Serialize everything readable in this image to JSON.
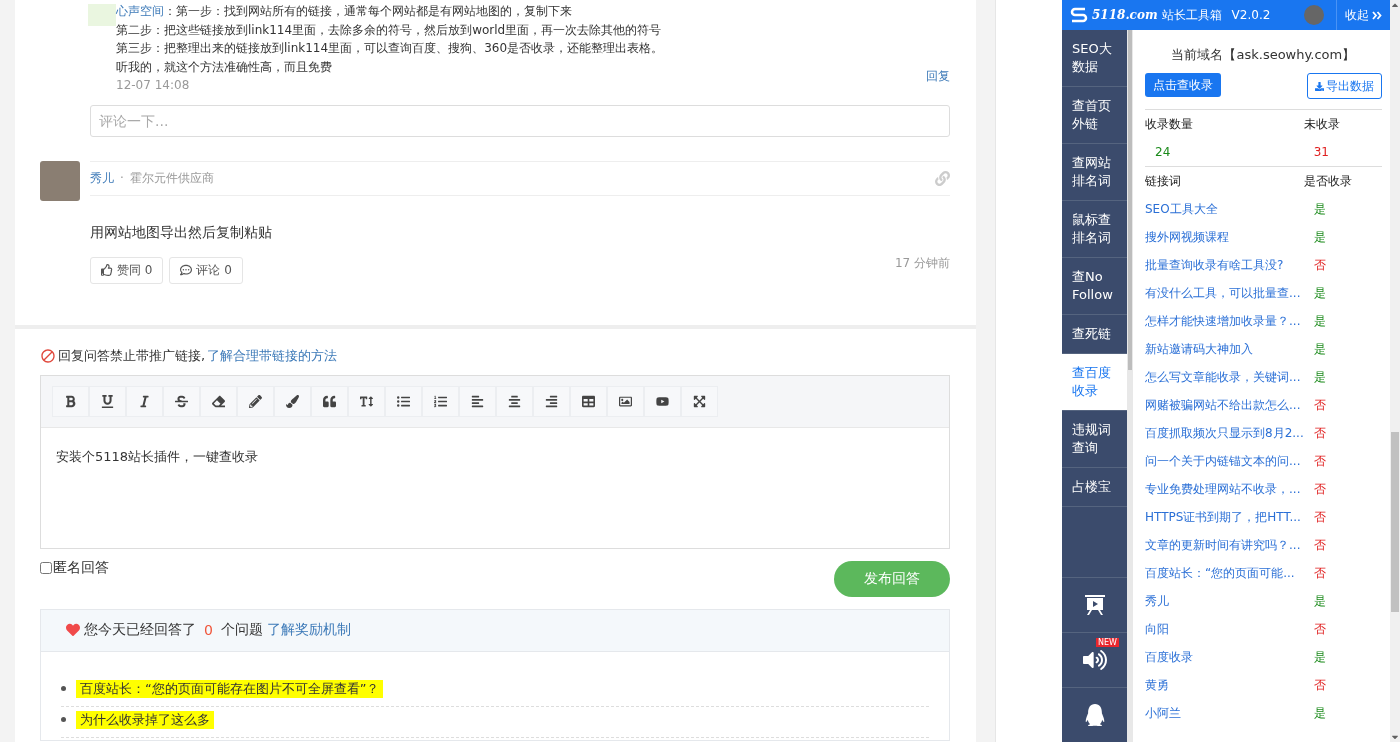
{
  "thread": {
    "top_comment": {
      "author": "心声空间",
      "lines": [
        "：第一步：找到网站所有的链接，通常每个网站都是有网站地图的，复制下来",
        "第二步：把这些链接放到link114里面，去除多余的符号，然后放到world里面，再一次去除其他的符号",
        "第三步：把整理出来的链接放到link114里面，可以查询百度、搜狗、360是否收录，还能整理出表格。",
        "听我的，就这个方法准确性高，而且免费"
      ],
      "time": "12-07 14:08",
      "reply": "回复"
    },
    "comment_field": {
      "placeholder": "评论一下..."
    },
    "answer": {
      "author": "秀儿",
      "dot": "·",
      "company": "霍尔元件供应商",
      "body": "用网站地图导出然后复制粘贴",
      "like": "赞同 0",
      "comment": "评论 0",
      "time": "17 分钟前"
    }
  },
  "reply_form": {
    "notice": "回复问答禁止带推广链接,",
    "notice_link": "了解合理带链接的方法",
    "content": "安装个5118站长插件，一键查收录",
    "anonymous": {
      "label": "匿名回答",
      "checked": false
    },
    "submit": "发布回答"
  },
  "daily_box": {
    "text_before": "您今天已经回答了",
    "count": "0",
    "text_after": "个问题",
    "link": "了解奖励机制",
    "items": [
      {
        "text": "百度站长：“您的页面可能存在图片不可全屏查看”？",
        "highlighted": true
      },
      {
        "text": "为什么收录掉了这么多",
        "highlighted": true
      }
    ]
  },
  "plugin": {
    "logo": "5118.com",
    "title": "站长工具箱",
    "version": "V2.0.2",
    "collapse": "收起",
    "nav": [
      {
        "label": "SEO大数据",
        "selected": false
      },
      {
        "label": "查首页外链",
        "selected": false
      },
      {
        "label": "查网站排名词",
        "selected": false
      },
      {
        "label": "鼠标查排名词",
        "selected": false
      },
      {
        "label": "查No Follow",
        "selected": false
      },
      {
        "label": "查死链",
        "selected": false
      },
      {
        "label": "查百度收录",
        "selected": true
      },
      {
        "label": "违规词查询",
        "selected": false
      },
      {
        "label": "占楼宝",
        "selected": false
      }
    ],
    "tools": [
      {
        "kind": "presentation"
      },
      {
        "kind": "speaker",
        "badge": "NEW"
      },
      {
        "kind": "penguin"
      }
    ],
    "domain": "当前域名【ask.seowhy.com】",
    "check_button": "点击查收录",
    "export_button": "导出数据",
    "summary_headers": [
      "收录数量",
      "未收录"
    ],
    "summary_values": [
      "24",
      "31"
    ],
    "table_headers": [
      "链接词",
      "是否收录"
    ],
    "rows": [
      {
        "word": "SEO工具大全",
        "status": "是",
        "included": true
      },
      {
        "word": "搜外网视频课程",
        "status": "是",
        "included": true
      },
      {
        "word": "批量查询收录有啥工具没?",
        "status": "否",
        "included": false
      },
      {
        "word": "有没什么工具，可以批量查...",
        "status": "是",
        "included": true
      },
      {
        "word": "怎样才能快速增加收录量？...",
        "status": "是",
        "included": true
      },
      {
        "word": "新站邀请码大神加入",
        "status": "是",
        "included": true
      },
      {
        "word": "怎么写文章能收录，关键词...",
        "status": "是",
        "included": true
      },
      {
        "word": "网赌被骗网站不给出款怎么...",
        "status": "否",
        "included": false
      },
      {
        "word": "百度抓取频次只显示到8月2...",
        "status": "否",
        "included": false
      },
      {
        "word": "问一个关于内链锚文本的问...",
        "status": "否",
        "included": false
      },
      {
        "word": "专业免费处理网站不收录，...",
        "status": "否",
        "included": false
      },
      {
        "word": "HTTPS证书到期了，把HTT...",
        "status": "否",
        "included": false
      },
      {
        "word": "文章的更新时间有讲究吗？...",
        "status": "否",
        "included": false
      },
      {
        "word": "百度站长：“您的页面可能...",
        "status": "否",
        "included": false
      },
      {
        "word": "秀儿",
        "status": "是",
        "included": true
      },
      {
        "word": "向阳",
        "status": "否",
        "included": false
      },
      {
        "word": "百度收录",
        "status": "是",
        "included": true
      },
      {
        "word": "黄勇",
        "status": "否",
        "included": false
      },
      {
        "word": "小阿兰",
        "status": "是",
        "included": true
      }
    ]
  }
}
